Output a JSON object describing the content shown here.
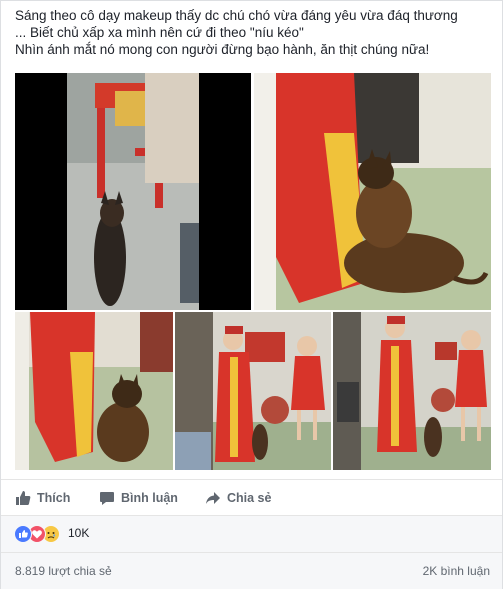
{
  "post": {
    "lines": [
      "Sáng theo cô dạy makeup thấy dc chú chó vừa đáng yêu vừa đáq thương",
      "... Biết chủ xấp xa mình nên cứ đi theo \"níu kéo\"",
      "Nhìn ánh mắt nó mong con người đừng bạo hành, ăn thịt chúng nữa!"
    ]
  },
  "media": [
    {
      "icon": "photo-dog-on-stool"
    },
    {
      "icon": "photo-dog-hugging-bride"
    },
    {
      "icon": "photo-dog-closeup"
    },
    {
      "icon": "photo-bride-and-guests"
    },
    {
      "icon": "photo-bride-with-dog"
    }
  ],
  "actions": {
    "like": "Thích",
    "comment": "Bình luận",
    "share": "Chia sẻ"
  },
  "reactions": {
    "icons": [
      "like-icon",
      "love-icon",
      "sad-icon"
    ],
    "count": "10K"
  },
  "footer": {
    "shares": "8.819 lượt chia sẻ",
    "comments": "2K bình luận"
  },
  "colors": {
    "like": "#4a7aff",
    "love": "#f25268",
    "sad": "#f7c845",
    "muted": "#606770",
    "bride_dress": "#d8342a",
    "dog": "#5a3a1e"
  }
}
